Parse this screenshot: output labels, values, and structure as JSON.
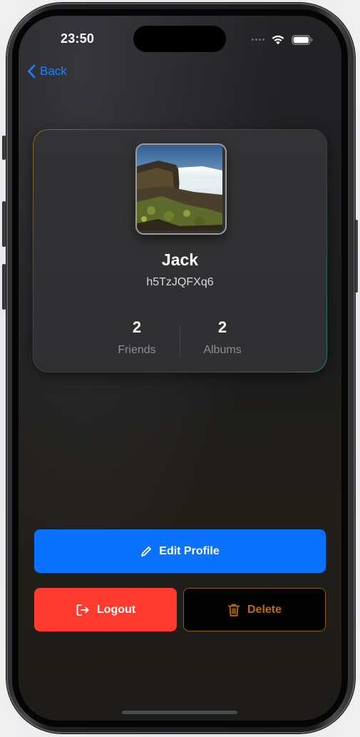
{
  "status_bar": {
    "time": "23:50"
  },
  "nav": {
    "back_label": "Back"
  },
  "profile": {
    "name": "Jack",
    "handle": "h5TzJQFXq6",
    "avatar": "waterfall-photo",
    "stats": [
      {
        "value": "2",
        "label": "Friends"
      },
      {
        "value": "2",
        "label": "Albums"
      }
    ]
  },
  "actions": {
    "edit_label": "Edit Profile",
    "logout_label": "Logout",
    "delete_label": "Delete"
  },
  "icons": {
    "back": "chevron-left-icon",
    "edit": "pencil-icon",
    "logout": "logout-icon",
    "delete": "trash-icon",
    "wifi": "wifi-icon",
    "battery": "battery-icon"
  },
  "colors": {
    "accent_blue": "#0a72ff",
    "back_link": "#1a84ff",
    "logout_red": "#ff3b2f",
    "delete_orange": "#b86e10",
    "background": "#1c1c1d"
  }
}
